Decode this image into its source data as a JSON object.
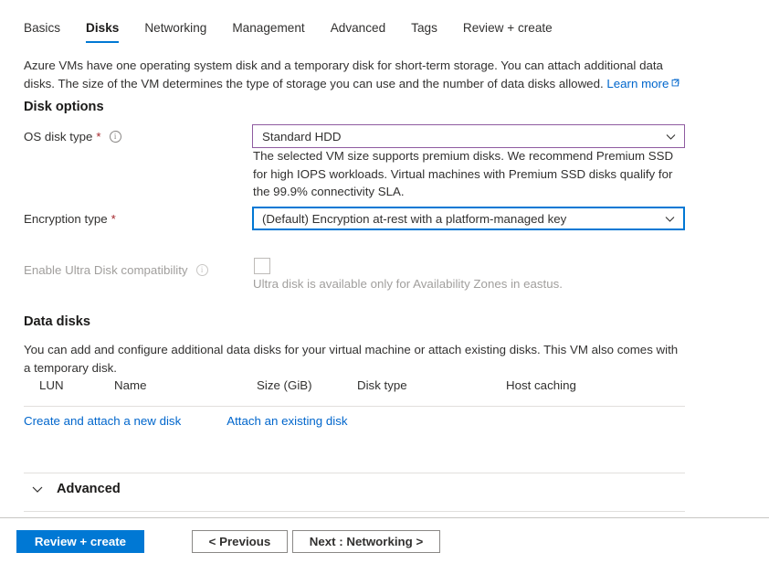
{
  "tabs": [
    {
      "label": "Basics",
      "active": false
    },
    {
      "label": "Disks",
      "active": true
    },
    {
      "label": "Networking",
      "active": false
    },
    {
      "label": "Management",
      "active": false
    },
    {
      "label": "Advanced",
      "active": false
    },
    {
      "label": "Tags",
      "active": false
    },
    {
      "label": "Review + create",
      "active": false
    }
  ],
  "intro": {
    "text": "Azure VMs have one operating system disk and a temporary disk for short-term storage. You can attach additional data disks. The size of the VM determines the type of storage you can use and the number of data disks allowed.",
    "link_label": "Learn more",
    "link_icon": "external-link-icon"
  },
  "disk_options": {
    "title": "Disk options",
    "os_disk_type": {
      "label": "OS disk type",
      "required_marker": "*",
      "info_icon": "info-icon",
      "value": "Standard HDD",
      "chevron_icon": "chevron-down-icon",
      "border_color": "#8f5ba0",
      "helper_text": "The selected VM size supports premium disks. We recommend Premium SSD for high IOPS workloads. Virtual machines with Premium SSD disks qualify for the 99.9% connectivity SLA."
    },
    "encryption_type": {
      "label": "Encryption type",
      "required_marker": "*",
      "value": "(Default) Encryption at-rest with a platform-managed key",
      "chevron_icon": "chevron-down-icon",
      "border_color": "#0078d4"
    },
    "ultra_disk": {
      "label": "Enable Ultra Disk compatibility",
      "info_icon": "info-icon",
      "checked": false,
      "disabled": true,
      "helper_text": "Ultra disk is available only for Availability Zones in eastus."
    }
  },
  "data_disks": {
    "title": "Data disks",
    "description": "You can add and configure additional data disks for your virtual machine or attach existing disks. This VM also comes with a temporary disk.",
    "columns": [
      "LUN",
      "Name",
      "Size (GiB)",
      "Disk type",
      "Host caching"
    ],
    "rows": [],
    "actions": [
      {
        "label": "Create and attach a new disk"
      },
      {
        "label": "Attach an existing disk"
      }
    ]
  },
  "advanced_section": {
    "label": "Advanced",
    "chevron_icon": "chevron-down-icon",
    "expanded": false
  },
  "footer": {
    "review_create_label": "Review + create",
    "previous_label": "< Previous",
    "next_label": "Next : Networking >"
  },
  "colors": {
    "accent": "#0078d4",
    "link": "#0066cc",
    "required": "#a4262c",
    "modified_border": "#8f5ba0",
    "disabled_text": "#a19f9d"
  }
}
